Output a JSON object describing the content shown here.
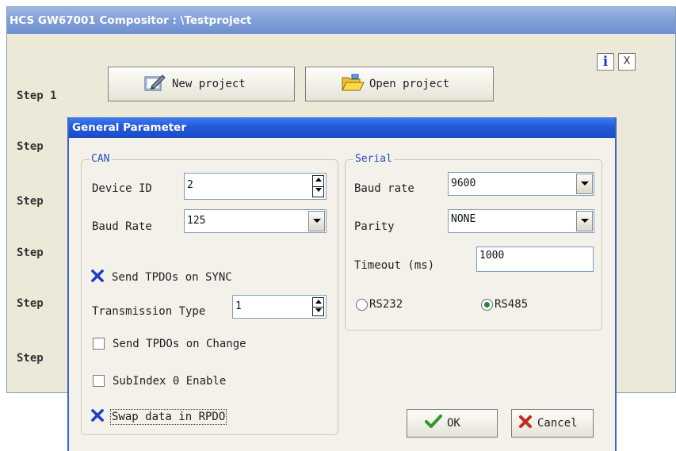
{
  "window": {
    "title": "HCS GW67001 Compositor : \\Testproject",
    "info_label": "i",
    "close_label": "X"
  },
  "steps": [
    "Step 1",
    "Step",
    "Step",
    "Step",
    "Step",
    "Step"
  ],
  "toolbar": {
    "new_project": "New project",
    "open_project": "Open project"
  },
  "dialog": {
    "title": "General Parameter",
    "can": {
      "legend": "CAN",
      "device_id_label": "Device ID",
      "device_id_value": "2",
      "baud_rate_label": "Baud Rate",
      "baud_rate_value": "125",
      "send_tpdos_sync": {
        "label": "Send TPDOs on SYNC",
        "checked": true
      },
      "transmission_type_label": "Transmission Type",
      "transmission_type_value": "1",
      "send_tpdos_change": {
        "label": "Send TPDOs on Change",
        "checked": false
      },
      "subindex_enable": {
        "label": "SubIndex 0 Enable",
        "checked": false
      },
      "swap_data": {
        "label": "Swap data in RPDO",
        "checked": true
      }
    },
    "serial": {
      "legend": "Serial",
      "baud_rate_label": "Baud rate",
      "baud_rate_value": "9600",
      "parity_label": "Parity",
      "parity_value": "NONE",
      "timeout_label": "Timeout (ms)",
      "timeout_value": "1000",
      "rs232_label": "RS232",
      "rs485_label": "RS485",
      "selected": "RS485"
    },
    "ok_label": "OK",
    "cancel_label": "Cancel"
  },
  "colors": {
    "title_bar": "#2459d9",
    "legend_text": "#1f4fc4",
    "check_mark": "#1d3fc9",
    "ok_check": "#2e9a2e",
    "cancel_x": "#c42a1e"
  }
}
